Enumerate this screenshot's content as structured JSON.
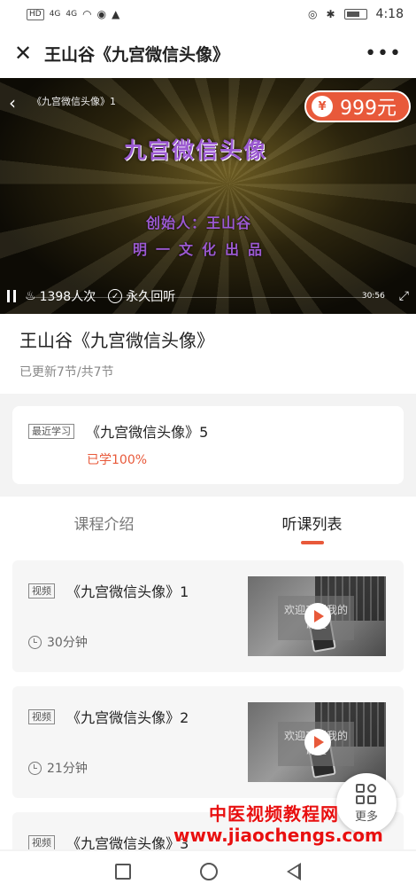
{
  "status_bar": {
    "network_chips": [
      "HD",
      "HD"
    ],
    "signal": [
      "4G",
      "4G"
    ],
    "time": "4:18"
  },
  "titlebar": {
    "close_icon": "close-icon",
    "title": "王山谷《九宫微信头像》",
    "more_icon": "more-icon"
  },
  "video": {
    "small_title": "《九宫微信头像》1",
    "price": "999元",
    "screen_title": "九宫微信头像",
    "screen_credit_1": "创始人：王山谷",
    "screen_credit_2": "明一文化出品",
    "views": "1398人次",
    "replay": "永久回听",
    "duration": "30:56"
  },
  "course": {
    "title": "王山谷《九宫微信头像》",
    "updated": "已更新7节/共7节"
  },
  "recent": {
    "tag": "最近学习",
    "name": "《九宫微信头像》5",
    "progress": "已学100%"
  },
  "tabs": [
    {
      "label": "课程介绍",
      "active": false
    },
    {
      "label": "听课列表",
      "active": true
    }
  ],
  "lessons": [
    {
      "tag": "视频",
      "name": "《九宫微信头像》1",
      "duration": "30分钟",
      "thumb_text": "欢迎来到我的课堂"
    },
    {
      "tag": "视频",
      "name": "《九宫微信头像》2",
      "duration": "21分钟",
      "thumb_text": "欢迎来到我的课堂"
    },
    {
      "tag": "视频",
      "name": "《九宫微信头像》3",
      "duration": "",
      "thumb_text": ""
    }
  ],
  "fab": {
    "label": "更多"
  },
  "watermark": {
    "line1": "中医视频教程网",
    "line2": "www.jiaochengs.com"
  },
  "colors": {
    "accent": "#e8593a",
    "watermark": "#e81010"
  }
}
